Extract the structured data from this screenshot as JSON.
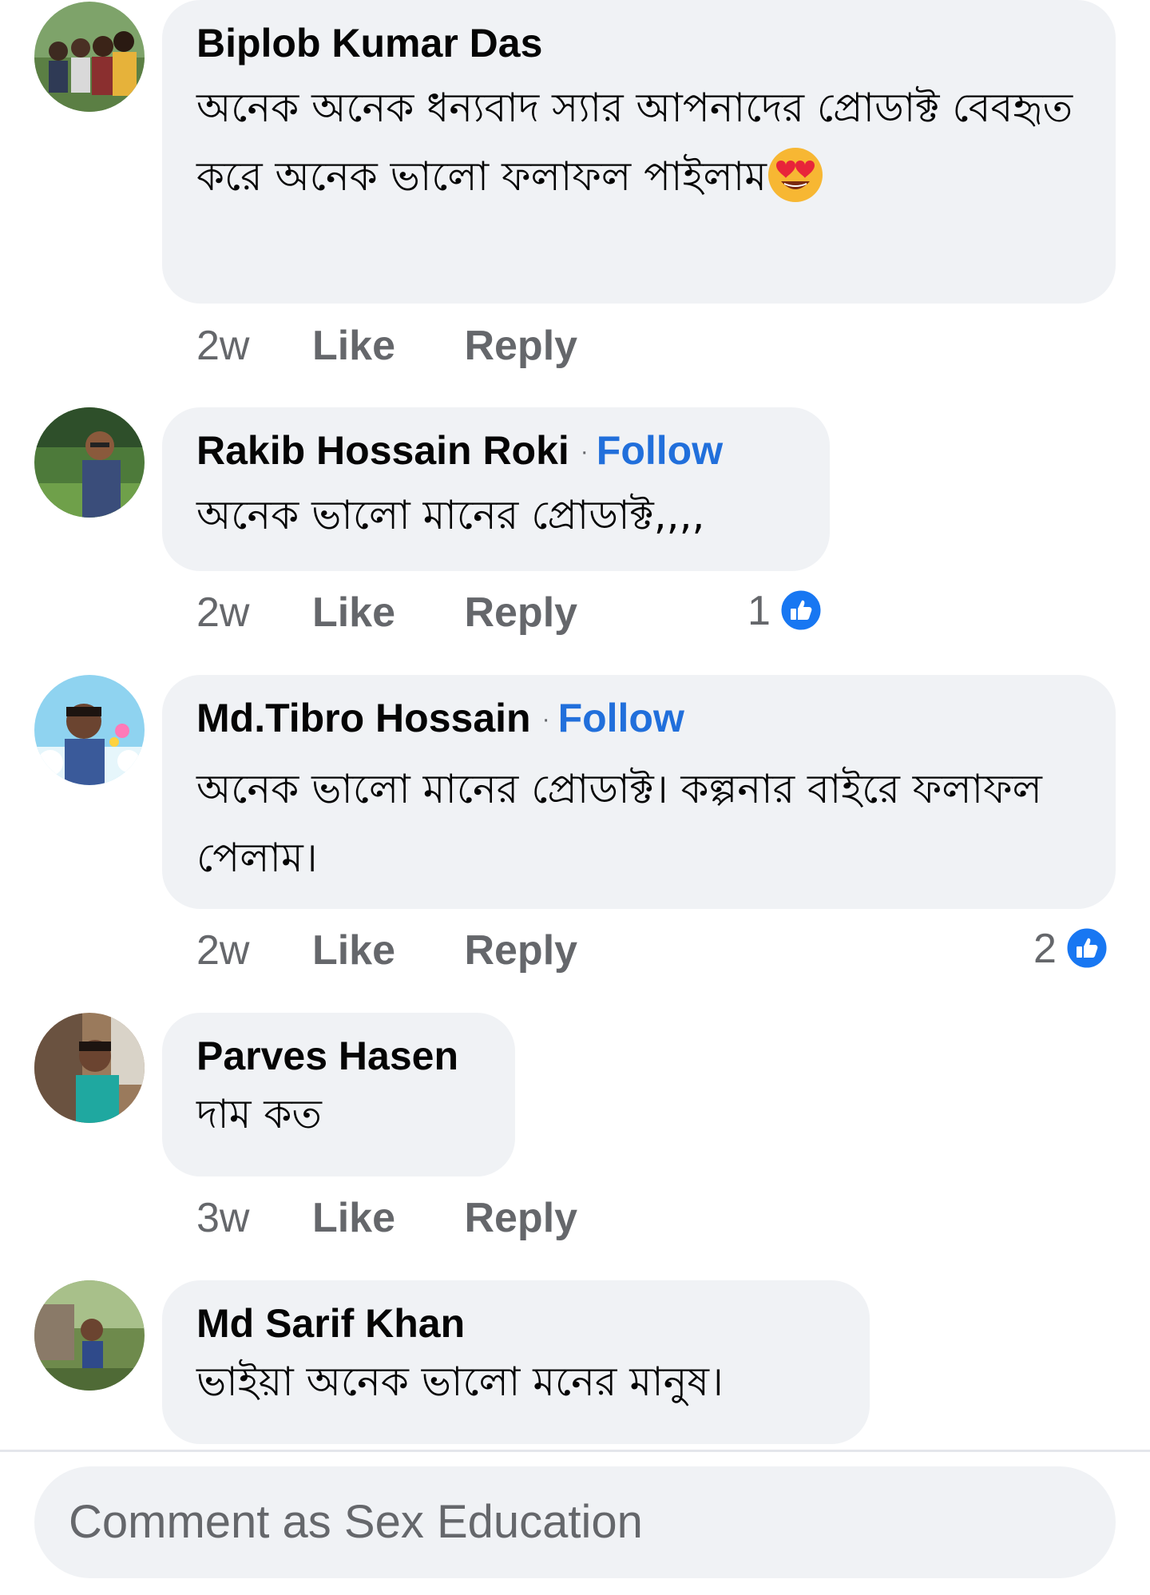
{
  "comments": [
    {
      "author": "Biplob Kumar Das",
      "follow": "",
      "text": "অনেক অনেক ধন্যবাদ স্যার আপনাদের প্রোডাক্ট  বেবহৃত  করে অনেক ভালো ফলাফল পাইলাম",
      "emoji": "heart-eyes-emoji",
      "time": "2w",
      "like": "Like",
      "reply": "Reply",
      "reaction_count": ""
    },
    {
      "author": "Rakib Hossain Roki",
      "follow": "Follow",
      "text": "অনেক ভালো মানের প্রোডাক্ট,,,,",
      "time": "2w",
      "like": "Like",
      "reply": "Reply",
      "reaction_count": "1"
    },
    {
      "author": "Md.Tibro Hossain",
      "follow": "Follow",
      "text": "অনেক ভালো মানের প্রোডাক্ট।  কল্পনার বাইরে ফলাফল পেলাম।",
      "time": "2w",
      "like": "Like",
      "reply": "Reply",
      "reaction_count": "2"
    },
    {
      "author": "Parves Hasen",
      "follow": "",
      "text": "দাম কত",
      "time": "3w",
      "like": "Like",
      "reply": "Reply",
      "reaction_count": ""
    },
    {
      "author": "Md Sarif Khan",
      "follow": "",
      "text": "ভাইয়া অনেক ভালো মনের মানুষ।",
      "time": "",
      "like": "",
      "reply": "",
      "reaction_count": ""
    }
  ],
  "composer": {
    "placeholder": "Comment as Sex Education"
  },
  "colors": {
    "bubble": "#f0f2f5",
    "follow": "#216fdb",
    "secondary_text": "#65676b",
    "like_badge": "#1877f2"
  }
}
